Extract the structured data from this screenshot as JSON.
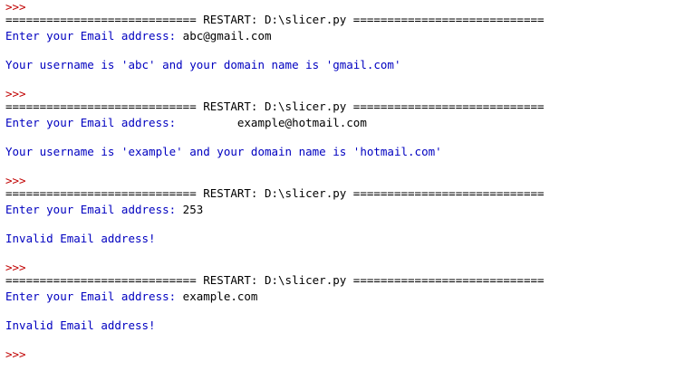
{
  "shell": {
    "prompt": ">>>",
    "sessions": [
      {
        "restart_banner": "============================ RESTART: D:\\slicer.py ============================",
        "input_prompt": "Enter your Email address: ",
        "input_value": "abc@gmail.com",
        "output": "Your username is 'abc' and your domain name is 'gmail.com'"
      },
      {
        "restart_banner": "============================ RESTART: D:\\slicer.py ============================",
        "input_prompt": "Enter your Email address:         ",
        "input_value": "example@hotmail.com",
        "output": "Your username is 'example' and your domain name is 'hotmail.com'"
      },
      {
        "restart_banner": "============================ RESTART: D:\\slicer.py ============================",
        "input_prompt": "Enter your Email address: ",
        "input_value": "253",
        "output": "Invalid Email address!"
      },
      {
        "restart_banner": "============================ RESTART: D:\\slicer.py ============================",
        "input_prompt": "Enter your Email address: ",
        "input_value": "example.com",
        "output": "Invalid Email address!"
      }
    ]
  },
  "colors": {
    "prompt": "#c00000",
    "stdout": "#0000c0",
    "text": "#000000",
    "background": "#ffffff"
  }
}
